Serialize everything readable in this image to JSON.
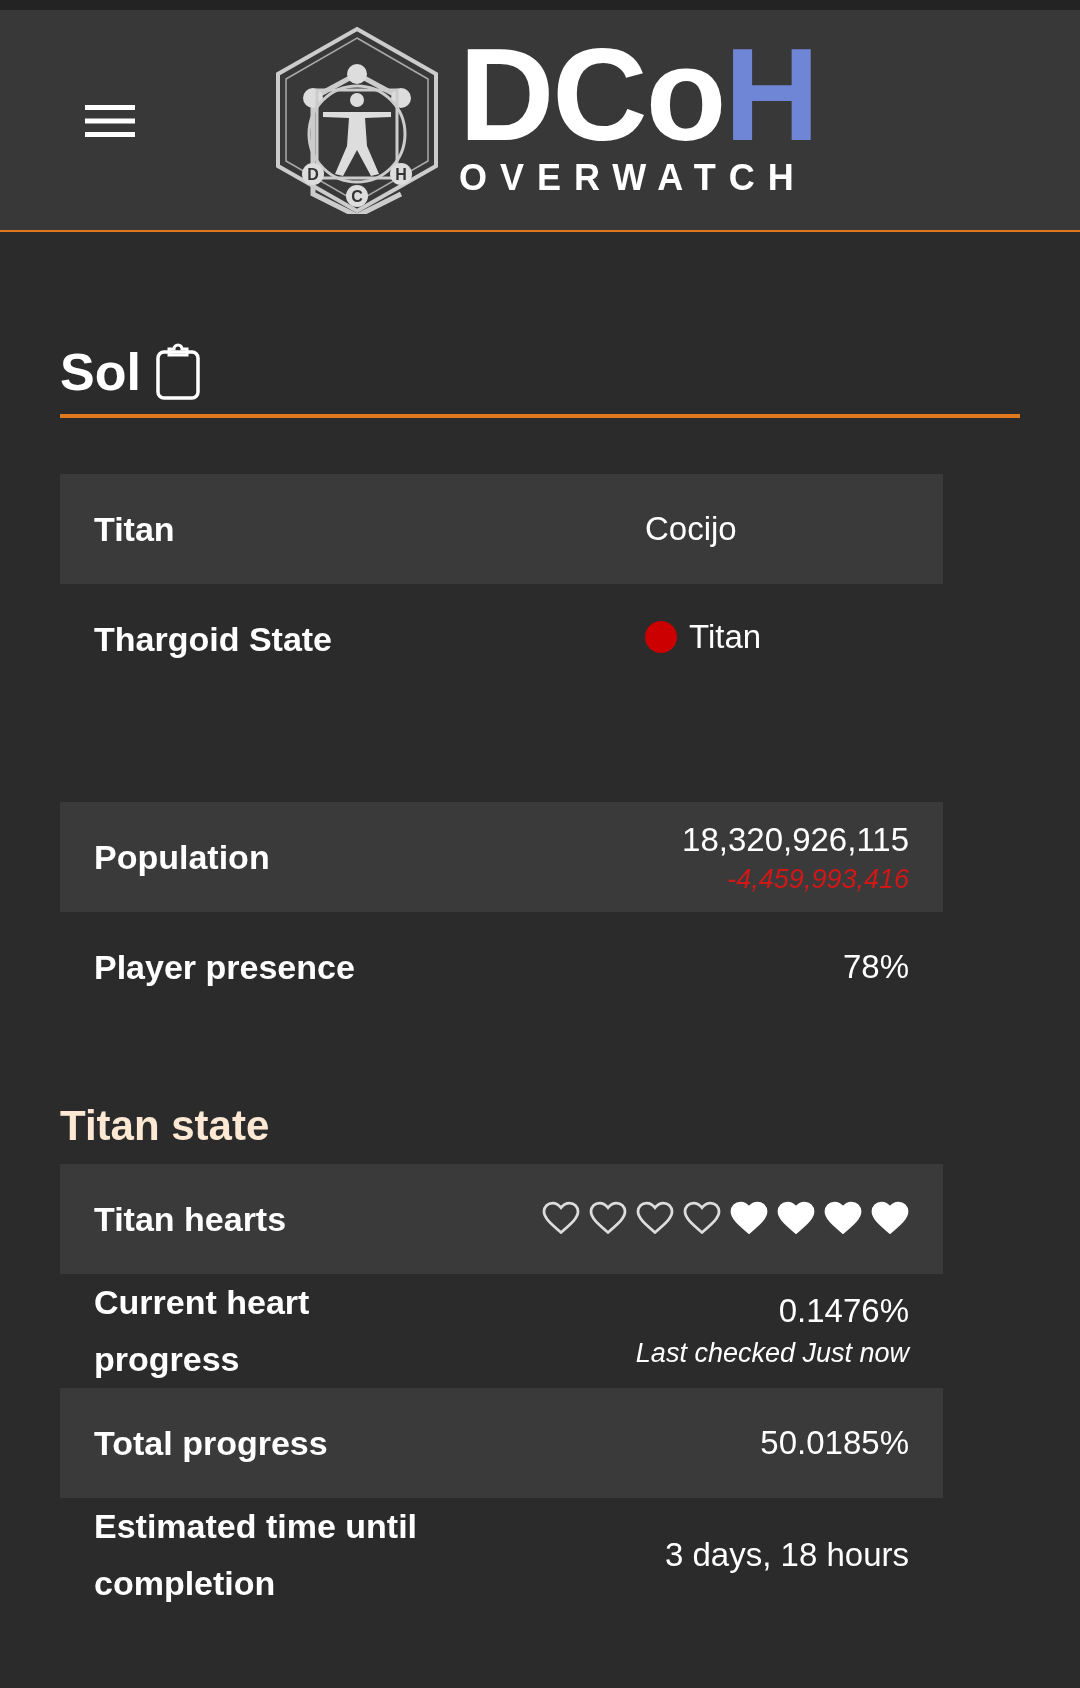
{
  "header": {
    "logo": {
      "main": "DCo",
      "accent": "H",
      "subtitle": "OVERWATCH",
      "emblem_letters": [
        "D",
        "C",
        "H"
      ]
    }
  },
  "system": {
    "name": "Sol"
  },
  "tables": [
    {
      "rows": [
        {
          "kind": "text",
          "label": "Titan",
          "value": "Cocijo"
        },
        {
          "kind": "state",
          "label": "Thargoid State",
          "value": "Titan",
          "color": "#cc0000"
        }
      ]
    },
    {
      "rows": [
        {
          "kind": "change",
          "label": "Population",
          "value": "18,320,926,115",
          "change": "-4,459,993,416"
        },
        {
          "kind": "text",
          "label": "Player presence",
          "value": "78%"
        }
      ]
    }
  ],
  "titan_state": {
    "heading": "Titan state",
    "rows": [
      {
        "kind": "hearts",
        "label": "Titan hearts",
        "hearts": [
          {
            "filled": false
          },
          {
            "filled": false
          },
          {
            "filled": false
          },
          {
            "filled": false
          },
          {
            "filled": true
          },
          {
            "filled": true
          },
          {
            "filled": true
          },
          {
            "filled": true
          }
        ]
      },
      {
        "kind": "note",
        "label": "Current heart progress",
        "value": "0.1476%",
        "note": "Last checked Just now"
      },
      {
        "kind": "text",
        "label": "Total progress",
        "value": "50.0185%"
      },
      {
        "kind": "text",
        "label": "Estimated time until completion",
        "value": "3 days, 18 hours"
      }
    ]
  }
}
